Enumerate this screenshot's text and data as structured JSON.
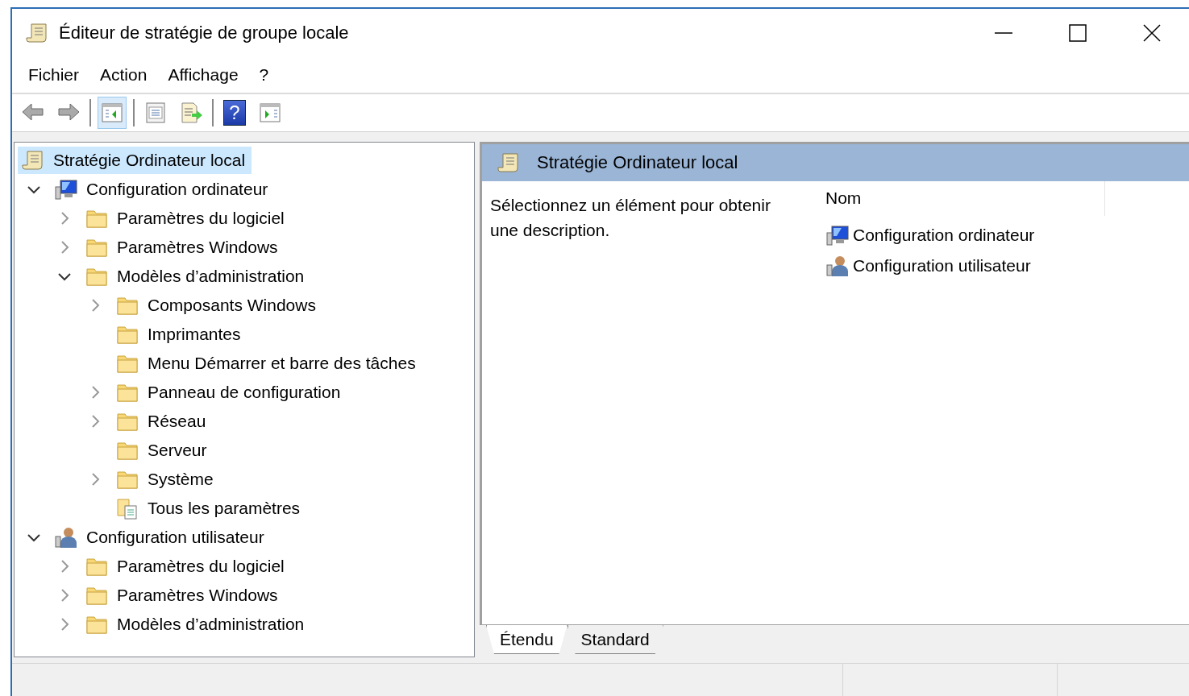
{
  "window": {
    "title": "Éditeur de stratégie de groupe locale"
  },
  "menu": [
    "Fichier",
    "Action",
    "Affichage",
    "?"
  ],
  "toolbar": [
    {
      "kind": "back",
      "pressed": false
    },
    {
      "kind": "forward",
      "pressed": false
    },
    {
      "kind": "separator"
    },
    {
      "kind": "tree",
      "pressed": true
    },
    {
      "kind": "separator"
    },
    {
      "kind": "properties",
      "pressed": false
    },
    {
      "kind": "export",
      "pressed": false
    },
    {
      "kind": "separator"
    },
    {
      "kind": "help",
      "pressed": false,
      "glyph": "?"
    },
    {
      "kind": "actionpane",
      "pressed": false
    }
  ],
  "tree": [
    {
      "label": "Stratégie Ordinateur local",
      "kind": "policy",
      "selected": true,
      "children": [
        {
          "label": "Configuration ordinateur",
          "kind": "computer",
          "selected": false,
          "expanded": true,
          "children": [
            {
              "label": "Paramètres du logiciel",
              "kind": "folder",
              "selected": false,
              "expanded": false
            },
            {
              "label": "Paramètres Windows",
              "kind": "folder",
              "selected": false,
              "expanded": false
            },
            {
              "label": "Modèles d’administration",
              "kind": "folder",
              "selected": false,
              "expanded": true,
              "children": [
                {
                  "label": "Composants Windows",
                  "kind": "folder",
                  "selected": false,
                  "expanded": false
                },
                {
                  "label": "Imprimantes",
                  "kind": "folder",
                  "selected": false
                },
                {
                  "label": "Menu Démarrer et barre des tâches",
                  "kind": "folder",
                  "selected": false
                },
                {
                  "label": "Panneau de configuration",
                  "kind": "folder",
                  "selected": false,
                  "expanded": false
                },
                {
                  "label": "Réseau",
                  "kind": "folder",
                  "selected": false,
                  "expanded": false
                },
                {
                  "label": "Serveur",
                  "kind": "folder",
                  "selected": false
                },
                {
                  "label": "Système",
                  "kind": "folder",
                  "selected": false,
                  "expanded": false
                },
                {
                  "label": "Tous les paramètres",
                  "kind": "settings",
                  "selected": false
                }
              ]
            }
          ]
        },
        {
          "label": "Configuration utilisateur",
          "kind": "user",
          "selected": false,
          "expanded": true,
          "children": [
            {
              "label": "Paramètres du logiciel",
              "kind": "folder",
              "selected": false,
              "expanded": false
            },
            {
              "label": "Paramètres Windows",
              "kind": "folder",
              "selected": false,
              "expanded": false
            },
            {
              "label": "Modèles d’administration",
              "kind": "folder",
              "selected": false,
              "expanded": false
            }
          ]
        }
      ]
    }
  ],
  "detail": {
    "title": "Stratégie Ordinateur local",
    "description": "Sélectionnez un élément pour obtenir une description.",
    "columns": [
      "Nom"
    ],
    "items": [
      {
        "label": "Configuration ordinateur",
        "kind": "computer"
      },
      {
        "label": "Configuration utilisateur",
        "kind": "user"
      }
    ]
  },
  "tabs": [
    {
      "label": "Étendu",
      "selected": true
    },
    {
      "label": "Standard",
      "selected": false
    }
  ]
}
